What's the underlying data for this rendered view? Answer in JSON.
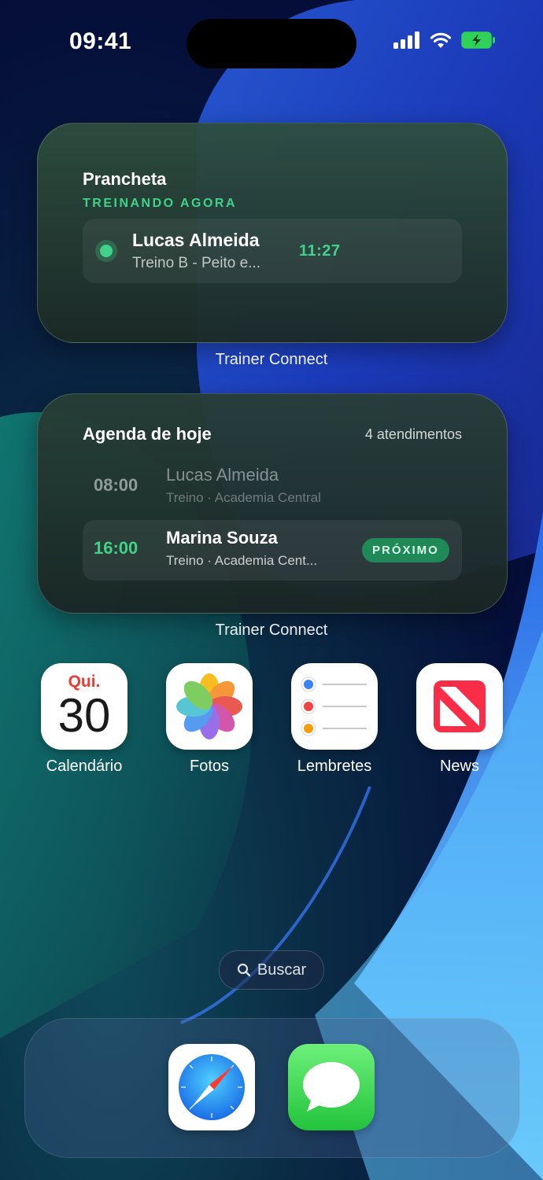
{
  "status_bar": {
    "time": "09:41"
  },
  "widget_live": {
    "title": "Prancheta",
    "subtitle": "TREINANDO AGORA",
    "client_name": "Lucas Almeida",
    "workout": "Treino B - Peito e...",
    "timer": "11:27",
    "app_label": "Trainer Connect"
  },
  "widget_agenda": {
    "title": "Agenda de hoje",
    "count": "4 atendimentos",
    "appointments": [
      {
        "time": "08:00",
        "name": "Lucas Almeida",
        "detail": "Treino · Academia Central"
      },
      {
        "time": "16:00",
        "name": "Marina Souza",
        "detail": "Treino · Academia Cent...",
        "badge": "PRÓXIMO"
      }
    ],
    "app_label": "Trainer Connect"
  },
  "apps": [
    {
      "label": "Calendário",
      "icon": "calendar-icon",
      "day_name": "Qui.",
      "day_number": "30"
    },
    {
      "label": "Fotos",
      "icon": "photos-icon"
    },
    {
      "label": "Lembretes",
      "icon": "reminders-icon"
    },
    {
      "label": "News",
      "icon": "news-icon"
    }
  ],
  "search": {
    "label": "Buscar"
  },
  "dock": [
    {
      "icon": "safari-icon"
    },
    {
      "icon": "messages-icon"
    }
  ],
  "colors": {
    "accent_green": "#3fd38a",
    "badge_bg": "#1f8a58"
  }
}
